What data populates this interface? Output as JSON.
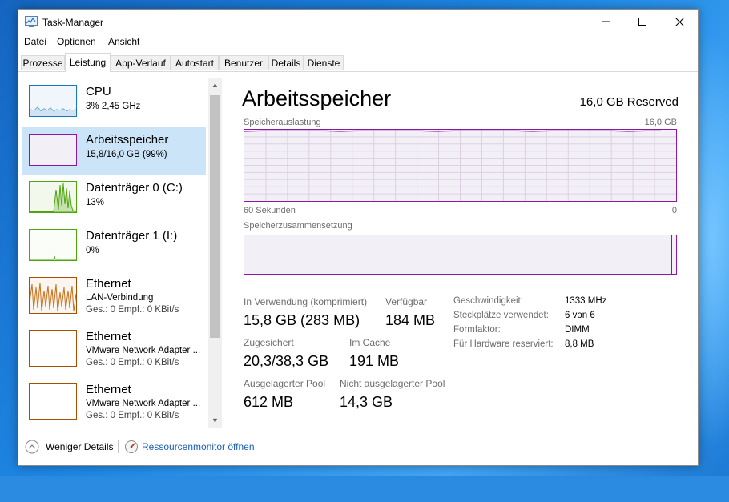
{
  "window": {
    "title": "Task-Manager",
    "controls": [
      "minimize-icon",
      "maximize-icon",
      "close-icon"
    ]
  },
  "menu": [
    "Datei",
    "Optionen",
    "Ansicht"
  ],
  "tabs": [
    {
      "label": "Prozesse",
      "active": false
    },
    {
      "label": "Leistung",
      "active": true
    },
    {
      "label": "App-Verlauf",
      "active": false
    },
    {
      "label": "Autostart",
      "active": false
    },
    {
      "label": "Benutzer",
      "active": false
    },
    {
      "label": "Details",
      "active": false
    },
    {
      "label": "Dienste",
      "active": false
    }
  ],
  "sidebar": {
    "items": [
      {
        "title": "CPU",
        "subtitle": "3% 2,45 GHz",
        "color": "#1779ba",
        "selected": false
      },
      {
        "title": "Arbeitsspeicher",
        "subtitle": "15,8/16,0 GB (99%)",
        "color": "#8b18a5",
        "selected": true
      },
      {
        "title": "Datenträger 0 (C:)",
        "subtitle": "13%",
        "color": "#4da60c",
        "selected": false
      },
      {
        "title": "Datenträger 1 (I:)",
        "subtitle": "0%",
        "color": "#4da60c",
        "selected": false
      },
      {
        "title": "Ethernet",
        "subtitle": "LAN-Verbindung",
        "subtitle2": "Ges.: 0 Empf.: 0 KBit/s",
        "color": "#a74f01",
        "selected": false
      },
      {
        "title": "Ethernet",
        "subtitle": "VMware Network Adapter ...",
        "subtitle2": "Ges.: 0 Empf.: 0 KBit/s",
        "color": "#a74f01",
        "selected": false
      },
      {
        "title": "Ethernet",
        "subtitle": "VMware Network Adapter ...",
        "subtitle2": "Ges.: 0 Empf.: 0 KBit/s",
        "color": "#a74f01",
        "selected": false
      }
    ]
  },
  "main": {
    "title": "Arbeitsspeicher",
    "reserved": "16,0 GB Reserved",
    "usage_label": "Speicherauslastung",
    "usage_max": "16,0 GB",
    "time_left": "60 Sekunden",
    "time_right": "0",
    "usage_level": 0.99,
    "composition_label": "Speicherzusammensetzung",
    "composition_in_use_fraction": 0.99,
    "stats": {
      "in_use_label": "In Verwendung (komprimiert)",
      "in_use_value": "15,8 GB (283 MB)",
      "available_label": "Verfügbar",
      "available_value": "184 MB",
      "committed_label": "Zugesichert",
      "committed_value": "20,3/38,3 GB",
      "cached_label": "Im Cache",
      "cached_value": "191 MB",
      "paged_label": "Ausgelagerter Pool",
      "paged_value": "612 MB",
      "nonpaged_label": "Nicht ausgelagerter Pool",
      "nonpaged_value": "14,3 GB"
    },
    "properties": [
      {
        "label": "Geschwindigkeit:",
        "value": "1333 MHz"
      },
      {
        "label": "Steckplätze verwendet:",
        "value": "6 von 6"
      },
      {
        "label": "Formfaktor:",
        "value": "DIMM"
      },
      {
        "label": "Für Hardware reserviert:",
        "value": "8,8 MB"
      }
    ]
  },
  "footer": {
    "fewer_details": "Weniger Details",
    "resource_monitor": "Ressourcenmonitor öffnen"
  },
  "colors": {
    "memory": "#8b18a5",
    "cpu": "#1779ba",
    "disk": "#4da60c",
    "ethernet": "#a74f01",
    "selection": "#cce4f7",
    "link": "#1a5fb4"
  }
}
